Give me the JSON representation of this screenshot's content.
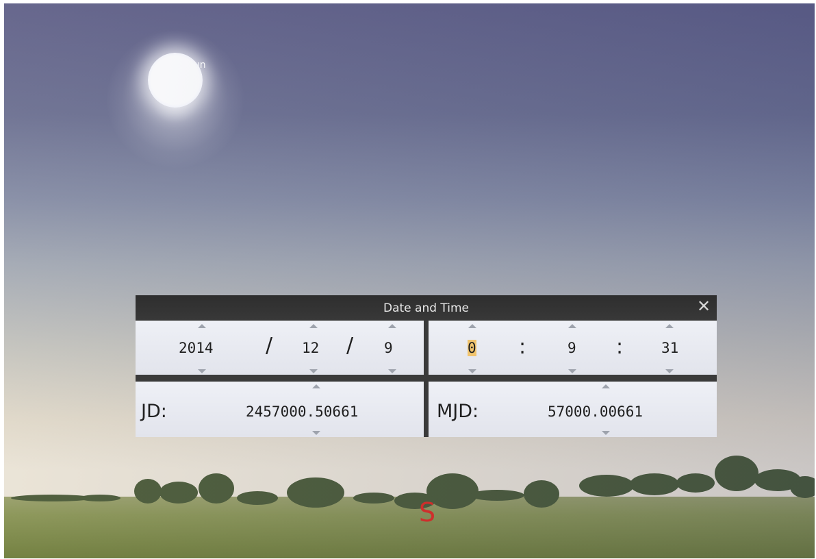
{
  "sky": {
    "sun_label": "Sun",
    "cardinal_south": "S"
  },
  "dialog": {
    "title": "Date and Time",
    "close_icon": "close-icon",
    "date": {
      "year": "2014",
      "month": "12",
      "day": "9",
      "separator": "/"
    },
    "time": {
      "hour": "0",
      "minute": "9",
      "second": "31",
      "separator": ":"
    },
    "jd": {
      "label": "JD:",
      "value": "2457000.50661"
    },
    "mjd": {
      "label": "MJD:",
      "value": "57000.00661"
    }
  },
  "colors": {
    "cardinal": "#e0291f",
    "highlight": "#f1c46e",
    "titlebar": "#2e2e2e"
  }
}
